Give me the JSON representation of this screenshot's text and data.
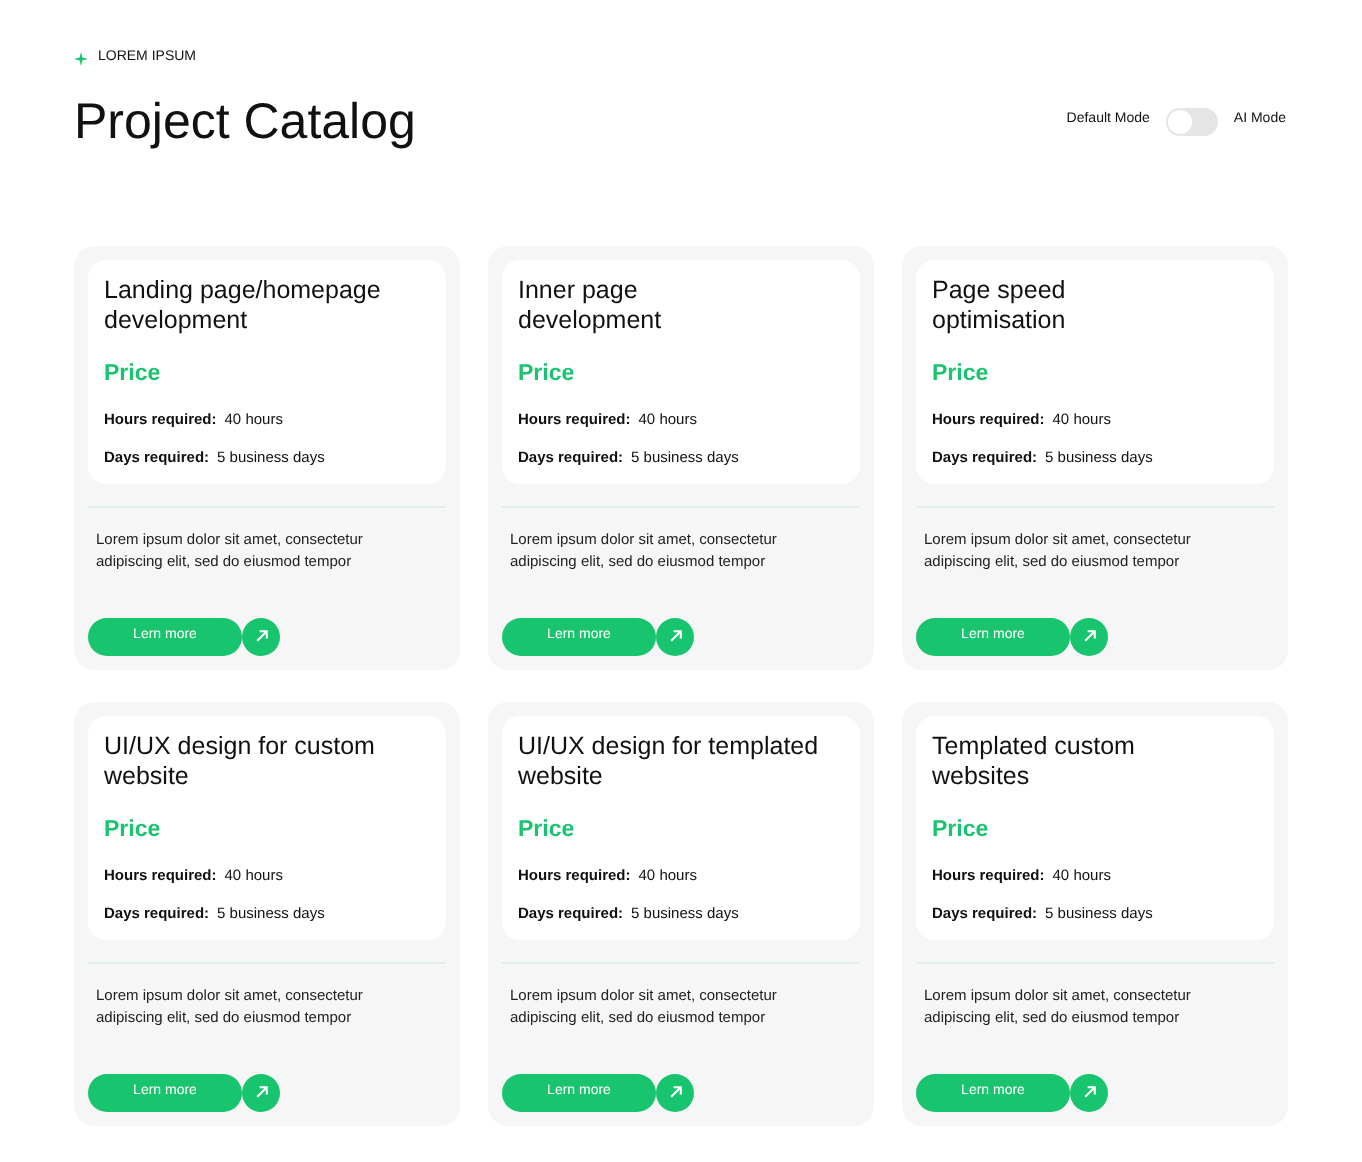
{
  "eyebrow": "LOREM IPSUM",
  "title": "Project Catalog",
  "mode_toggle": {
    "left_label": "Default Mode",
    "right_label": "AI Mode",
    "on": false
  },
  "cards": [
    {
      "title": "Landing page/homepage\ndevelopment",
      "price": "Price",
      "hours_label": "Hours required:",
      "hours": "40 hours",
      "days_label": "Days required:",
      "days": "5 business days",
      "description": "Lorem ipsum dolor sit amet, consectetur adipiscing elit, sed do eiusmod tempor",
      "button": "Lern more"
    },
    {
      "title": "Inner page\ndevelopment",
      "price": "Price",
      "hours_label": "Hours required:",
      "hours": "40 hours",
      "days_label": "Days required:",
      "days": "5 business days",
      "description": "Lorem ipsum dolor sit amet, consectetur adipiscing elit, sed do eiusmod tempor",
      "button": "Lern more"
    },
    {
      "title": "Page speed\noptimisation",
      "price": "Price",
      "hours_label": "Hours required:",
      "hours": "40 hours",
      "days_label": "Days required:",
      "days": "5 business days",
      "description": "Lorem ipsum dolor sit amet, consectetur adipiscing elit, sed do eiusmod tempor",
      "button": "Lern more"
    },
    {
      "title": "UI/UX design for custom\nwebsite",
      "price": "Price",
      "hours_label": "Hours required:",
      "hours": "40 hours",
      "days_label": "Days required:",
      "days": "5 business days",
      "description": "Lorem ipsum dolor sit amet, consectetur adipiscing elit, sed do eiusmod tempor",
      "button": "Lern more"
    },
    {
      "title": "UI/UX design for templated\nwebsite",
      "price": "Price",
      "hours_label": "Hours required:",
      "hours": "40 hours",
      "days_label": "Days required:",
      "days": "5 business days",
      "description": "Lorem ipsum dolor sit amet, consectetur adipiscing elit, sed do eiusmod tempor",
      "button": "Lern more"
    },
    {
      "title": "Templated custom\nwebsites",
      "price": "Price",
      "hours_label": "Hours required:",
      "hours": "40 hours",
      "days_label": "Days required:",
      "days": "5 business days",
      "description": "Lorem ipsum dolor sit amet, consectetur adipiscing elit, sed do eiusmod tempor",
      "button": "Lern more"
    }
  ]
}
